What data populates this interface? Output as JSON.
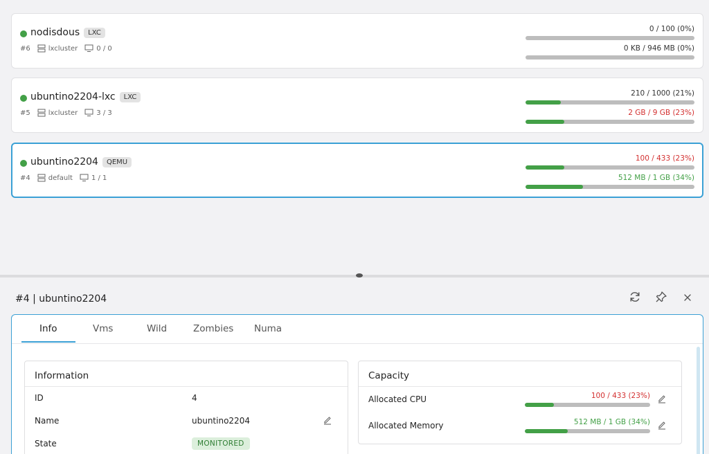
{
  "vms": [
    {
      "status_color": "#43a047",
      "name": "nodisdous",
      "type": "LXC",
      "id": "#6",
      "cluster": "lxcluster",
      "vms": "0 / 0",
      "cpu_label": "0 / 100 (0%)",
      "cpu_pct": 0,
      "mem_label": "0 KB / 946 MB (0%)",
      "mem_pct": 0
    },
    {
      "status_color": "#43a047",
      "name": "ubuntino2204-lxc",
      "type": "LXC",
      "id": "#5",
      "cluster": "lxcluster",
      "vms": "3 / 3",
      "cpu_label": "210 / 1000 (21%)",
      "cpu_pct": 21,
      "mem_label": "2 GB / 9 GB (23%)",
      "mem_pct": 23
    },
    {
      "status_color": "#43a047",
      "name": "ubuntino2204",
      "type": "QEMU",
      "id": "#4",
      "cluster": "default",
      "vms": "1 / 1",
      "cpu_label": "100 / 433 (23%)",
      "cpu_pct": 23,
      "mem_label": "512 MB / 1 GB (34%)",
      "mem_pct": 34
    }
  ],
  "detail": {
    "title": "#4 | ubuntino2204",
    "tabs": [
      "Info",
      "Vms",
      "Wild",
      "Zombies",
      "Numa"
    ],
    "active_tab": "Info",
    "information": {
      "title": "Information",
      "rows": [
        {
          "key": "ID",
          "value": "4"
        },
        {
          "key": "Name",
          "value": "ubuntino2204"
        },
        {
          "key": "State",
          "value": "MONITORED"
        }
      ]
    },
    "capacity": {
      "title": "Capacity",
      "rows": [
        {
          "key": "Allocated CPU",
          "label": "100 / 433 (23%)",
          "pct": 23
        },
        {
          "key": "Allocated Memory",
          "label": "512 MB / 1 GB (34%)",
          "pct": 34
        }
      ]
    }
  },
  "colors": {
    "accent": "#3aa0d5",
    "ok": "#43a047",
    "warn": "#d32f2f",
    "track": "#bdbdbd"
  },
  "icons": [
    "cluster-icon",
    "monitor-icon",
    "refresh-icon",
    "pin-icon",
    "close-icon",
    "edit-icon"
  ]
}
